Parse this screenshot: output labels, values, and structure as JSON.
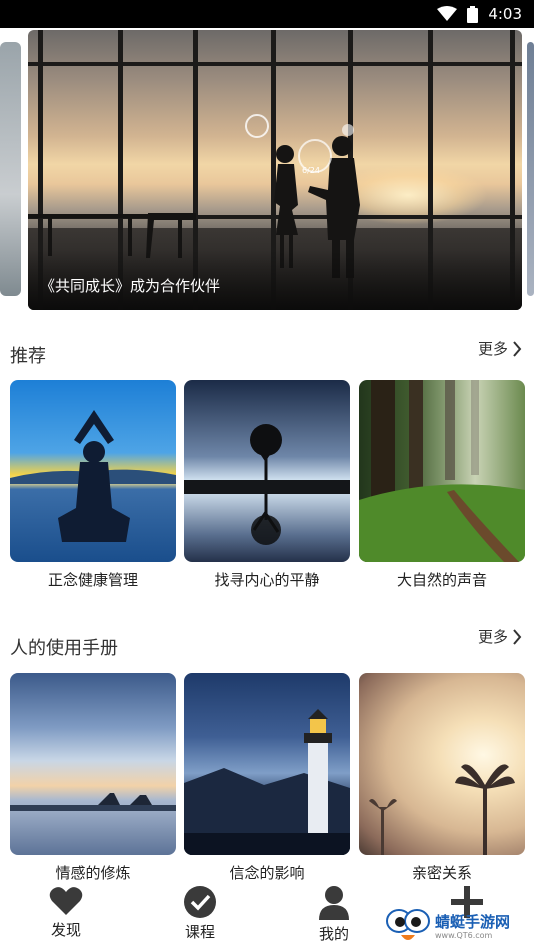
{
  "status_bar": {
    "time": "4:03"
  },
  "banner": {
    "caption": "《共同成长》成为合作伙伴",
    "overlay_text": "6/24"
  },
  "sections": [
    {
      "title": "推荐",
      "more": "更多",
      "cards": [
        {
          "label": "正念健康管理"
        },
        {
          "label": "找寻内心的平静"
        },
        {
          "label": "大自然的声音"
        }
      ]
    },
    {
      "title": "人的使用手册",
      "more": "更多",
      "cards": [
        {
          "label": "情感的修炼"
        },
        {
          "label": "信念的影响"
        },
        {
          "label": "亲密关系"
        }
      ]
    }
  ],
  "nav": {
    "discover": "发现",
    "courses": "课程",
    "mine": "我的"
  },
  "watermark": {
    "title": "蜻蜓手游网",
    "url": "www.QT6.com"
  },
  "icons": {
    "wifi": "wifi-icon",
    "battery": "battery-icon",
    "more": "chevron-right-icon",
    "discover": "heart-icon",
    "courses": "check-circle-icon",
    "mine": "person-icon",
    "add": "plus-icon"
  },
  "colors": {
    "status_bar": "#000000",
    "watermark": "#1a5fb4"
  }
}
